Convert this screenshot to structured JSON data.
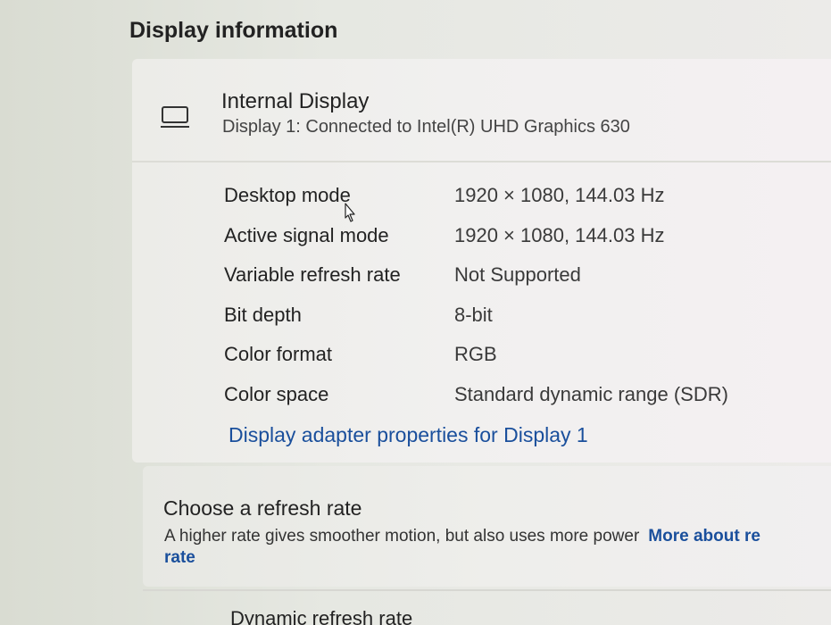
{
  "section": {
    "title": "Display information"
  },
  "display": {
    "icon": "monitor-icon",
    "name": "Internal Display",
    "subtitle": "Display 1: Connected to Intel(R) UHD Graphics 630"
  },
  "info": {
    "rows": [
      {
        "label": "Desktop mode",
        "value": "1920 × 1080, 144.03 Hz"
      },
      {
        "label": "Active signal mode",
        "value": "1920 × 1080, 144.03 Hz"
      },
      {
        "label": "Variable refresh rate",
        "value": "Not Supported"
      },
      {
        "label": "Bit depth",
        "value": "8-bit"
      },
      {
        "label": "Color format",
        "value": "RGB"
      },
      {
        "label": "Color space",
        "value": "Standard dynamic range (SDR)"
      }
    ],
    "adapter_link": "Display adapter properties for Display 1"
  },
  "refresh": {
    "title": "Choose a refresh rate",
    "description": "A higher rate gives smoother motion, but also uses more power",
    "more_link": "More about re",
    "more_link_cont": "rate"
  },
  "dynamic": {
    "label": "Dynamic refresh rate"
  },
  "colors": {
    "link": "#1a4f9c",
    "card": "#f1f0ef"
  }
}
